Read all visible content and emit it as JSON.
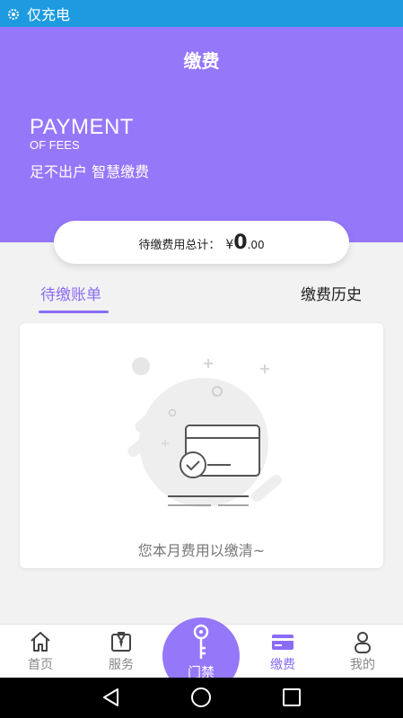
{
  "status_bar": {
    "app_name": "仅充电",
    "icon": "settings-gear-icon"
  },
  "header": {
    "title": "缴费",
    "eng_title": "PAYMENT",
    "eng_subtitle": "OF FEES",
    "slogan": "足不出户 智慧缴费",
    "background_color": "#9577fa"
  },
  "total": {
    "label": "待缴费用总计：",
    "currency": "¥",
    "amount_integer": "0",
    "amount_decimal": ".00"
  },
  "tabs": [
    {
      "label": "待缴账单",
      "active": true
    },
    {
      "label": "缴费历史",
      "active": false
    }
  ],
  "empty_state": {
    "message": "您本月费用以缴清~",
    "icon": "card-paid-check-icon"
  },
  "bottom_nav": {
    "items": [
      {
        "label": "首页",
        "icon": "home-icon",
        "active": false
      },
      {
        "label": "服务",
        "icon": "service-suit-icon",
        "active": false
      },
      {
        "label": "门禁",
        "icon": "key-icon",
        "active": false
      },
      {
        "label": "缴费",
        "icon": "card-icon",
        "active": true
      },
      {
        "label": "我的",
        "icon": "user-icon",
        "active": false
      }
    ],
    "accent_color": "#8a6cf4"
  },
  "system_nav": {
    "buttons": [
      "back-triangle-icon",
      "home-circle-icon",
      "recents-square-icon"
    ]
  }
}
